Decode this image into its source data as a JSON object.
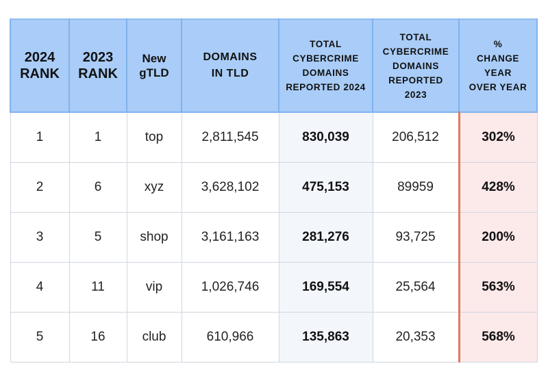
{
  "colors": {
    "header_bg": "#a9cdf8",
    "highlight_col_bg": "#f3f7fc",
    "pct_col_bg": "#fce9ea",
    "pct_col_accent": "#e07a5f"
  },
  "headers": [
    [
      "2024",
      "RANK"
    ],
    [
      "2023",
      "RANK"
    ],
    [
      "New",
      "gTLD"
    ],
    [
      "DOMAINS",
      "IN TLD"
    ],
    [
      "TOTAL",
      "CYBERCRIME",
      "DOMAINS",
      "REPORTED 2024"
    ],
    [
      "TOTAL",
      "CYBERCRIME",
      "DOMAINS",
      "REPORTED",
      "2023"
    ],
    [
      "%",
      "CHANGE",
      "YEAR",
      "OVER YEAR"
    ]
  ],
  "rows": [
    [
      "1",
      "1",
      "top",
      "2,811,545",
      "830,039",
      "206,512",
      "302%"
    ],
    [
      "2",
      "6",
      "xyz",
      "3,628,102",
      "475,153",
      "89959",
      "428%"
    ],
    [
      "3",
      "5",
      "shop",
      "3,161,163",
      "281,276",
      "93,725",
      "200%"
    ],
    [
      "4",
      "11",
      "vip",
      "1,026,746",
      "169,554",
      "25,564",
      "563%"
    ],
    [
      "5",
      "16",
      "club",
      "610,966",
      "135,863",
      "20,353",
      "568%"
    ]
  ]
}
